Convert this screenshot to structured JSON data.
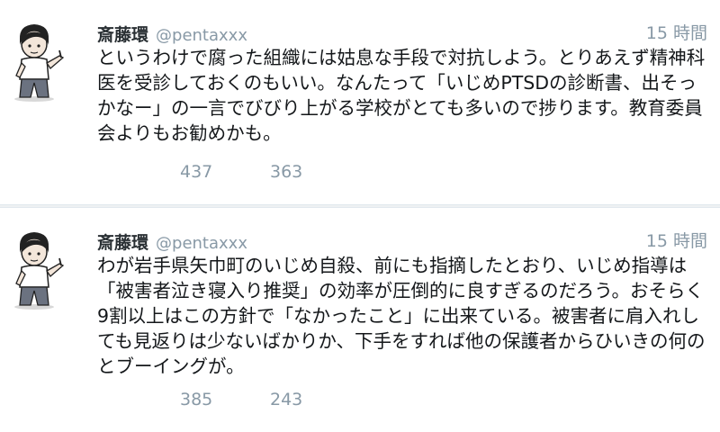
{
  "tweets": [
    {
      "name": "斎藤環",
      "handle": "@pentaxxx",
      "time": "15 時間",
      "text": "というわけで腐った組織には姑息な手段で対抗しよう。とりあえず精神科医を受診しておくのもいい。なんたって「いじめPTSDの診断書、出そっかなー」の一言でびびり上がる学校がとても多いので捗ります。教育委員会よりもお勧めかも。",
      "retweets": "437",
      "favorites": "363"
    },
    {
      "name": "斎藤環",
      "handle": "@pentaxxx",
      "time": "15 時間",
      "text": "わが岩手県矢巾町のいじめ自殺、前にも指摘したとおり、いじめ指導は「被害者泣き寝入り推奨」の効率が圧倒的に良すぎるのだろう。おそらく9割以上はこの方針で「なかったこと」に出来ている。被害者に肩入れしても見返りは少ないばかりか、下手をすれば他の保護者からひいきの何のとブーイングが。",
      "retweets": "385",
      "favorites": "243"
    }
  ],
  "avatar_icon": "cartoon-man-avatar-icon"
}
